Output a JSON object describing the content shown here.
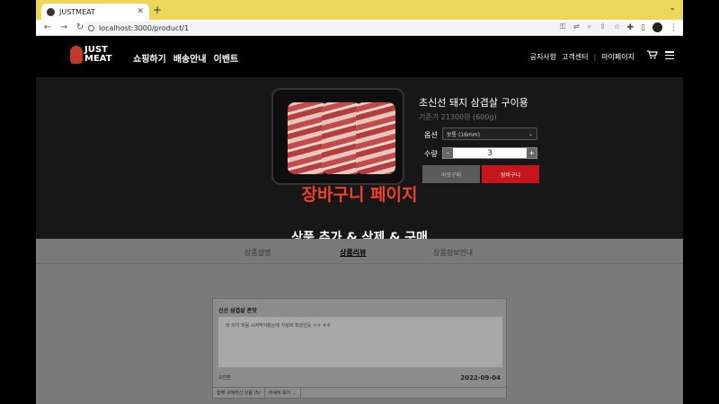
{
  "browser": {
    "tab_title": "JUSTMEAT",
    "tab_close": "✕",
    "new_tab": "+",
    "tab_menu": "⌄",
    "url": "localhost:3000/product/1",
    "back": "←",
    "forward": "→",
    "reload": "↻"
  },
  "site": {
    "logo_line1": "JUST",
    "logo_line2": "MEAT",
    "nav": [
      "쇼핑하기",
      "배송안내",
      "이벤트"
    ],
    "util": [
      "공지사항",
      "고객센터",
      "마이페이지"
    ],
    "util_sep": "|"
  },
  "product": {
    "title": "초신선 돼지 삼겹살 구이용",
    "price": "기준가 21300원 (600g)",
    "option_label": "옵션",
    "option_value": "보통 (16mm)",
    "option_arrow": "⌄",
    "qty_label": "수량",
    "qty_minus": "-",
    "qty_value": "3",
    "qty_plus": "+",
    "buy_label": "바로구매",
    "cart_label": "장바구니"
  },
  "overlay": {
    "line1": "장바구니 페이지",
    "line2": "상품 추가 & 삭제 & 구매"
  },
  "detail_tabs": [
    "상품설명",
    "상품리뷰",
    "상품정보안내"
  ],
  "detail_tabs_active": 1,
  "review": {
    "title": "신선 삼겹살 존맛",
    "body": "와 이거 처음 시켜먹어봤는데 가성비 최강인듯 ㅇㅇ ㅎㅎ",
    "author": "오민환",
    "date": "2022-09-04",
    "footer": [
      "함께 구매하신 상품 (5)",
      "자세히 보기 ..."
    ]
  },
  "colors": {
    "tabbar": "#ecd75b",
    "accent_red": "#c4161c",
    "overlay_red": "#f2402a"
  }
}
